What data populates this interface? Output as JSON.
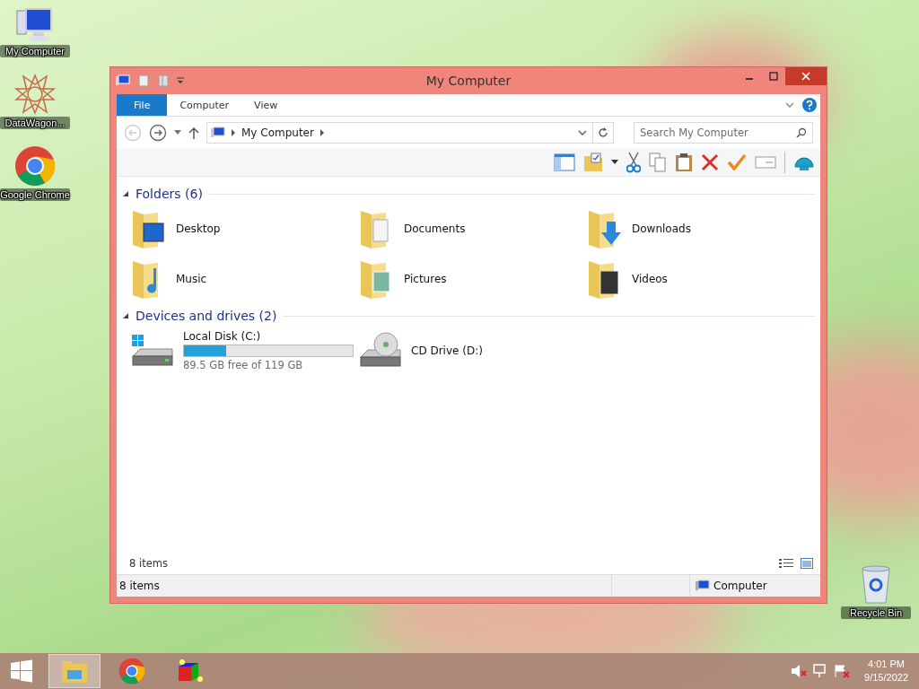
{
  "desktop_icons": [
    {
      "kind": "computer",
      "label": "My Computer"
    },
    {
      "kind": "star",
      "label": "DataWagon..."
    },
    {
      "kind": "chrome",
      "label": "Google Chrome"
    },
    {
      "kind": "bin",
      "label": "Recycle Bin"
    }
  ],
  "window": {
    "title": "My Computer",
    "ribbon_tabs": [
      {
        "label": "File",
        "selected": true
      },
      {
        "label": "Computer",
        "selected": false
      },
      {
        "label": "View",
        "selected": false
      }
    ],
    "address": {
      "path": "My Computer"
    },
    "search": {
      "placeholder": "Search My Computer"
    },
    "sections": [
      {
        "title": "Folders (6)",
        "expanded": true,
        "items": [
          {
            "kind": "desktop",
            "name": "Desktop"
          },
          {
            "kind": "documents",
            "name": "Documents"
          },
          {
            "kind": "downloads",
            "name": "Downloads"
          },
          {
            "kind": "music",
            "name": "Music"
          },
          {
            "kind": "pictures",
            "name": "Pictures"
          },
          {
            "kind": "videos",
            "name": "Videos"
          }
        ]
      },
      {
        "title": "Devices and drives (2)",
        "expanded": true,
        "items": [
          {
            "kind": "disk",
            "name": "Local Disk (C:)",
            "level": 0.25,
            "free": "89.5 GB free of 119 GB"
          },
          {
            "kind": "cd",
            "name": "CD Drive (D:)"
          }
        ]
      }
    ],
    "item_count": "8 items",
    "status_bar": {
      "left": "8 items",
      "right": "Computer"
    }
  },
  "taskbar": {
    "apps": [
      {
        "kind": "explorer",
        "selected": true
      },
      {
        "kind": "chrome",
        "selected": false
      },
      {
        "kind": "cube",
        "selected": false
      }
    ],
    "time": "4:01 PM",
    "date": "9/15/2022"
  }
}
